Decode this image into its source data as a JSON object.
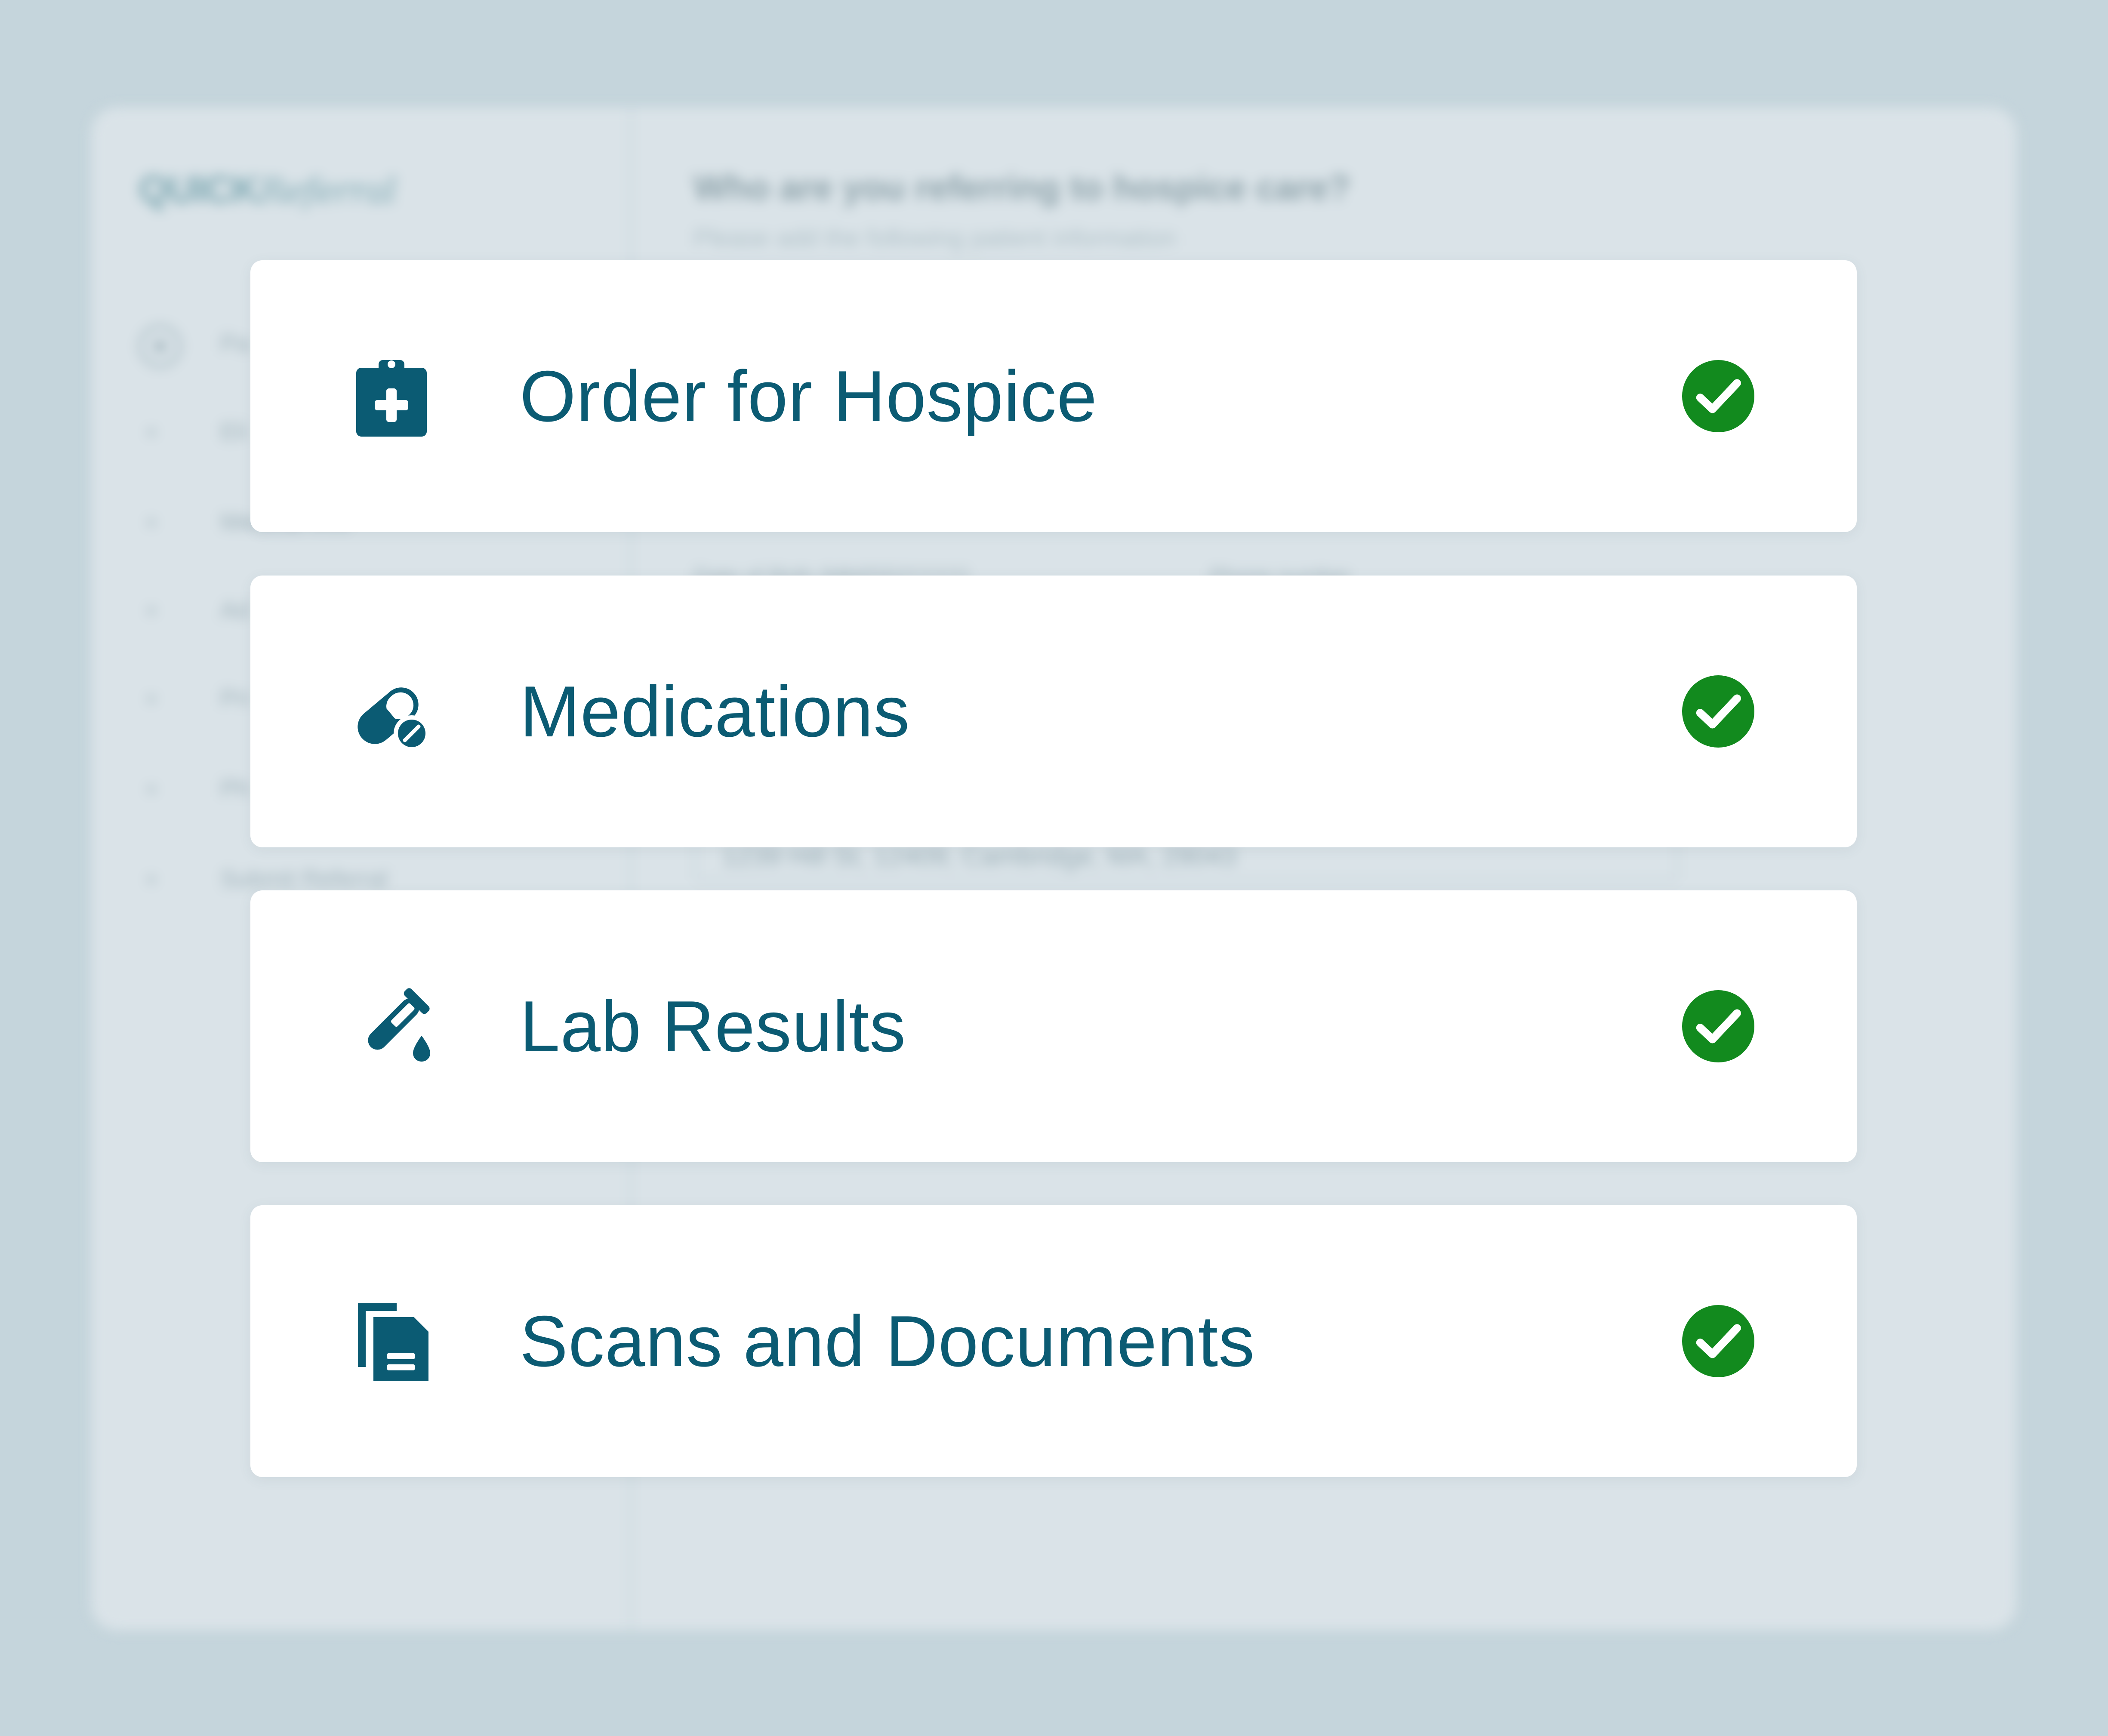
{
  "colors": {
    "background": "#c5d5dc",
    "panel": "#dae3e8",
    "card": "#ffffff",
    "label_text": "#0b5b73",
    "icon": "#0b5b73",
    "check": "#128a1e"
  },
  "background_app": {
    "logo": {
      "brand": "QUICK",
      "script": "Referral"
    },
    "heading": "Who are you referring to hospice care?",
    "subheading": "Please add the following patient information",
    "steps": [
      "Pa",
      "Eli",
      "Medical Info",
      "Ad",
      "Pri",
      "Ph",
      "Submit Referral"
    ],
    "fields": {
      "dob": "Date of Birth (MM/DD/YYYY)",
      "phone": "Phone number",
      "address": "1239 Hill St, 12409, Cambridge, MA, 29043"
    }
  },
  "cards": [
    {
      "label": "Order for Hospice",
      "icon": "clipboard-medical-icon",
      "status": "complete"
    },
    {
      "label": "Medications",
      "icon": "pills-icon",
      "status": "complete"
    },
    {
      "label": "Lab Results",
      "icon": "test-tube-icon",
      "status": "complete"
    },
    {
      "label": "Scans and Documents",
      "icon": "documents-icon",
      "status": "complete"
    }
  ]
}
